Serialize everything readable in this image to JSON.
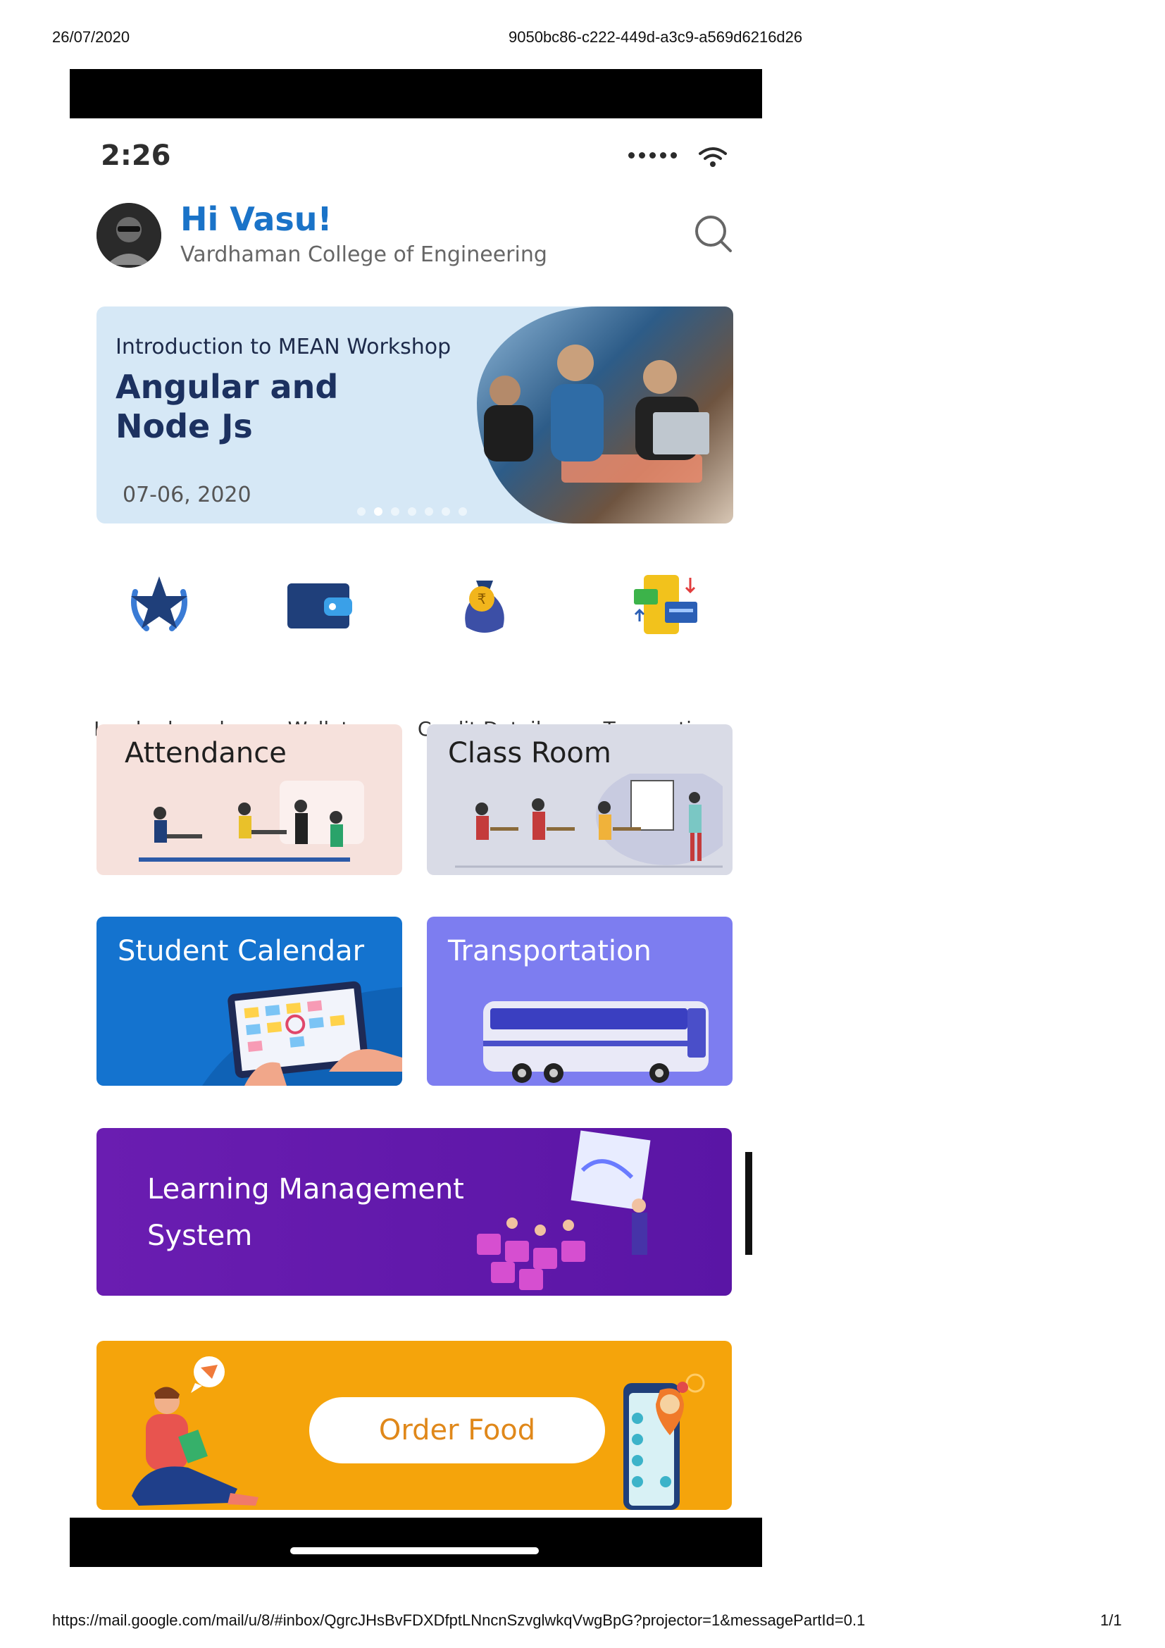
{
  "print_header": {
    "date": "26/07/2020",
    "doc_id": "9050bc86-c222-449d-a3c9-a569d6216d26"
  },
  "print_footer": {
    "url": "https://mail.google.com/mail/u/8/#inbox/QgrcJHsBvFDXDfptLNncnSzvglwkqVwgBpG?projector=1&messagePartId=0.1",
    "page": "1/1"
  },
  "status_bar": {
    "time": "2:26",
    "signal_icon": "signal-dots-icon",
    "wifi_icon": "wifi-icon"
  },
  "header": {
    "greeting": "Hi Vasu!",
    "college": "Vardhaman College of Engineering",
    "search_icon": "search-icon"
  },
  "banner": {
    "subtitle": "Introduction to MEAN Workshop",
    "title_line1": "Angular and",
    "title_line2": "Node Js",
    "date": "07-06, 2020",
    "pager_count": 7,
    "active_index": 1
  },
  "quick_actions": [
    {
      "label": "Leader board",
      "icon": "star-laurel-icon"
    },
    {
      "label": "Wallet",
      "icon": "wallet-icon"
    },
    {
      "label": "Credit Details",
      "icon": "money-bag-icon"
    },
    {
      "label": "Transactions",
      "icon": "transactions-icon"
    }
  ],
  "tiles": {
    "attendance": "Attendance",
    "classroom": "Class Room",
    "calendar": "Student Calendar",
    "transport": "Transportation",
    "lms_line1": "Learning Management",
    "lms_line2": "System",
    "order_food": "Order Food"
  },
  "colors": {
    "accent": "#1a73c8",
    "attendance_bg": "#f6e1dc",
    "classroom_bg": "#d9dbe6",
    "calendar_bg": "#1473cf",
    "transport_bg": "#7d7df0",
    "lms_bg": "#6a1db1",
    "order_bg": "#f5a40b"
  }
}
